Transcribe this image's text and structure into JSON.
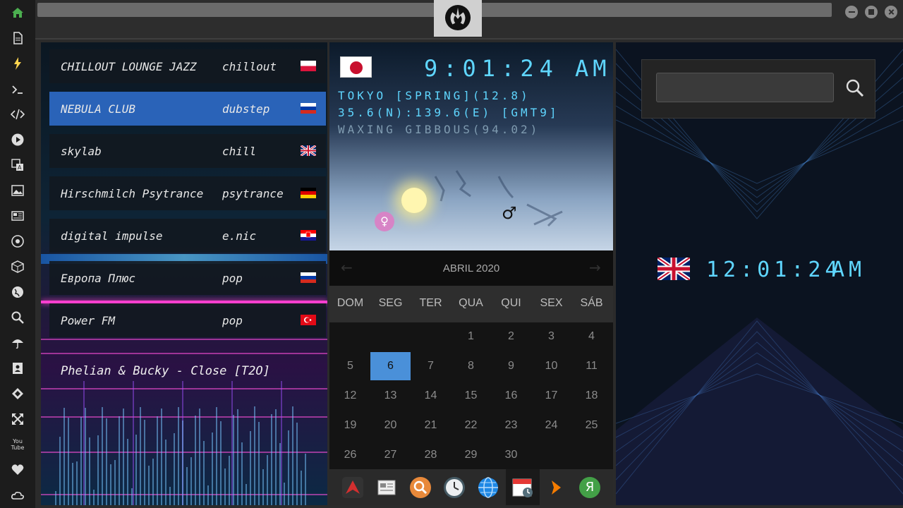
{
  "sidebar": {
    "icons": [
      "home-icon",
      "document-icon",
      "flash-icon",
      "terminal-icon",
      "code-icon",
      "play-icon",
      "translate-icon",
      "image-icon",
      "news-icon",
      "rebel-icon",
      "cube-icon",
      "globe-icon",
      "search-icon",
      "umbrella-icon",
      "contact-icon",
      "bug-icon",
      "resize-icon",
      "youtube-icon",
      "heart-icon",
      "cloud-icon"
    ],
    "youtube_label": "You Tube",
    "accent": "#4caf50"
  },
  "radio": {
    "stations": [
      {
        "name": "CHILLOUT LOUNGE JAZZ",
        "genre": "chillout",
        "flag": "poland"
      },
      {
        "name": "NEBULA CLUB",
        "genre": "dubstep",
        "flag": "russia"
      },
      {
        "name": "skylab",
        "genre": "chill",
        "flag": "uk"
      },
      {
        "name": "Hirschmilch Psytrance",
        "genre": "psytrance",
        "flag": "germany"
      },
      {
        "name": "digital impulse",
        "genre": "e.nic",
        "flag": "croatia"
      },
      {
        "name": "Европа Плюс",
        "genre": "pop",
        "flag": "russia"
      },
      {
        "name": "Power FM",
        "genre": "pop",
        "flag": "turkey"
      }
    ],
    "selected_index": 1,
    "now_playing": "Phelian & Bucky - Close [T2O]",
    "active_color": "#2a63b8"
  },
  "tokyo": {
    "time": "9:01:24",
    "ampm": "AM",
    "line1": "TOKYO [SPRING](12.8)",
    "line2": "35.6(N):139.6(E) [GMT9]",
    "line3": "WAXING GIBBOUS(94.02)",
    "venus_symbol": "♀",
    "mars_symbol": "♂"
  },
  "calendar": {
    "month_label": "ABRIL 2020",
    "prev": "←",
    "next": "→",
    "weekdays": [
      "DOM",
      "SEG",
      "TER",
      "QUA",
      "QUI",
      "SEX",
      "SÁB"
    ],
    "weeks": [
      [
        "",
        "",
        "",
        "1",
        "2",
        "3",
        "4"
      ],
      [
        "5",
        "6",
        "7",
        "8",
        "9",
        "10",
        "11"
      ],
      [
        "12",
        "13",
        "14",
        "15",
        "16",
        "17",
        "18"
      ],
      [
        "19",
        "20",
        "21",
        "22",
        "23",
        "24",
        "25"
      ],
      [
        "26",
        "27",
        "28",
        "29",
        "30",
        "",
        ""
      ]
    ],
    "today": "6",
    "today_color": "#4a90d9"
  },
  "dock": {
    "apps": [
      "red-launcher-icon",
      "news-reader-icon",
      "search-app-icon",
      "clock-app-icon",
      "globe-app-icon",
      "calendar-app-icon",
      "play-arrow-icon",
      "yandex-icon"
    ],
    "yandex_letter": "Я",
    "active_app": "calendar-app-icon"
  },
  "search": {
    "placeholder": ""
  },
  "london": {
    "time": "12:01:24",
    "ampm": "AM",
    "flag": "uk"
  },
  "colors": {
    "digital": "#5fd6ff"
  }
}
